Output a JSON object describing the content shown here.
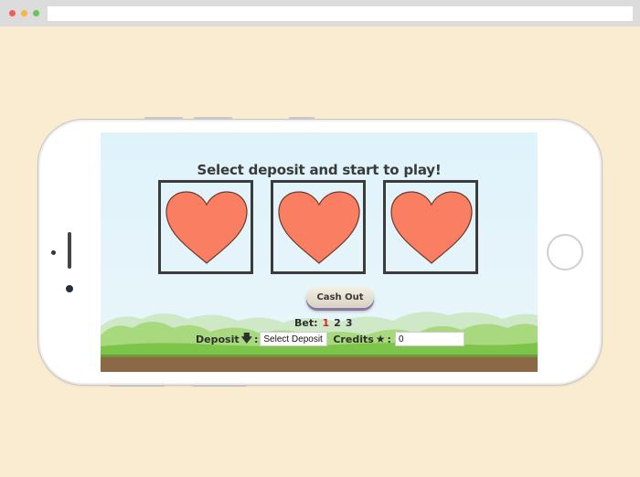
{
  "game": {
    "title": "Select deposit and start to play!",
    "reels": [
      {
        "symbol": "heart-icon",
        "color": "#fa7f62"
      },
      {
        "symbol": "heart-icon",
        "color": "#fa7f62"
      },
      {
        "symbol": "heart-icon",
        "color": "#fa7f62"
      }
    ],
    "cash_out_label": "Cash Out",
    "bet_label": "Bet:",
    "bet_options": [
      "1",
      "2",
      "3"
    ],
    "bet_selected": "1",
    "deposit_label": "Deposit",
    "deposit_icon": "down-arrow-icon",
    "deposit_colon": ":",
    "deposit_value": "Select Deposit",
    "credits_label": "Credits",
    "credits_icon": "star-icon",
    "credits_colon": ":",
    "credits_value": "0"
  },
  "colors": {
    "heart": "#fa7f62",
    "reel_border": "#3c3c3c",
    "active_bet": "#e02323",
    "page_background": "#f9ecd0"
  }
}
